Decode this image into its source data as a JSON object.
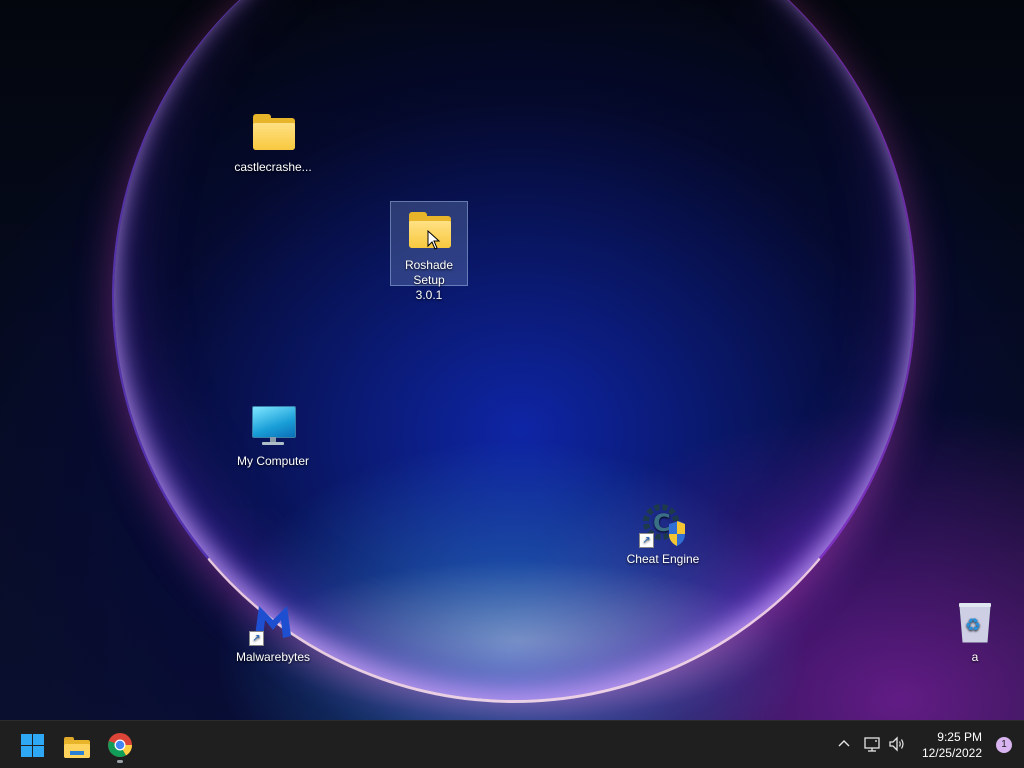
{
  "desktop": {
    "icons": [
      {
        "label": "castlecrashe...",
        "icon": "folder-icon"
      },
      {
        "label": "Roshade Setup 3.0.1",
        "icon": "folder-icon",
        "selected": true
      },
      {
        "label": "My Computer",
        "icon": "monitor-icon"
      },
      {
        "label": "Cheat Engine",
        "icon": "cheat-engine-icon",
        "shortcut": true
      },
      {
        "label": "Malwarebytes",
        "icon": "malwarebytes-icon",
        "shortcut": true
      },
      {
        "label": "a",
        "icon": "recycle-bin-icon"
      }
    ]
  },
  "taskbar": {
    "pinned": [
      {
        "name": "Start",
        "icon": "windows-logo-icon"
      },
      {
        "name": "File Explorer",
        "icon": "file-explorer-icon"
      },
      {
        "name": "Google Chrome",
        "icon": "chrome-icon",
        "running": true
      }
    ],
    "tray": {
      "icons": [
        "chevron-up-icon",
        "network-icon",
        "volume-icon"
      ],
      "time": "9:25 PM",
      "date": "12/25/2022",
      "notification_count": "1"
    }
  },
  "colors": {
    "taskbar_bg": "#1f1f1f",
    "accent": "#2ea8f5",
    "folder": "#f8c93f",
    "notification_badge": "#d8b4f0"
  }
}
